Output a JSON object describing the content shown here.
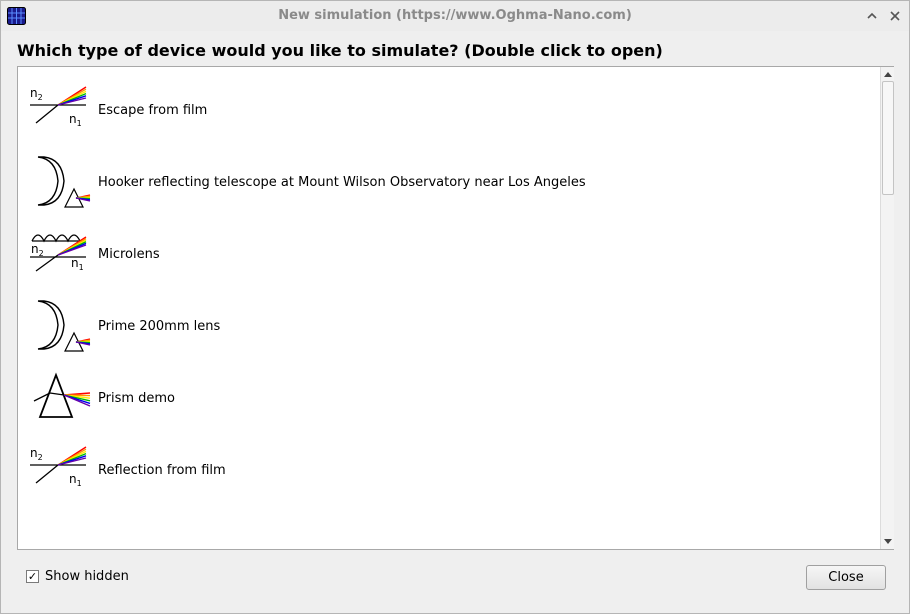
{
  "window": {
    "title": "New simulation (https://www.Oghma-Nano.com)",
    "app_icon": "grid-app-icon"
  },
  "heading": "Which type of device would you like to simulate? (Double click to open)",
  "list": {
    "items": [
      {
        "label": "Escape from film",
        "icon": "refraction-icon"
      },
      {
        "label": "Hooker reflecting telescope at Mount Wilson Observatory near Los Angeles",
        "icon": "mirror-prism-icon"
      },
      {
        "label": "Microlens",
        "icon": "microlens-icon"
      },
      {
        "label": "Prime 200mm lens",
        "icon": "mirror-prism-icon"
      },
      {
        "label": "Prism demo",
        "icon": "prism-icon"
      },
      {
        "label": "Reflection from film",
        "icon": "refraction-icon"
      }
    ],
    "n_labels": {
      "top": "n",
      "top_sub": "2",
      "bottom": "n",
      "bottom_sub": "1"
    }
  },
  "footer": {
    "show_hidden_label": "Show hidden",
    "show_hidden_checked": true,
    "check_glyph": "✓",
    "close_label": "Close"
  },
  "colors": {
    "rainbow": [
      "#ff0000",
      "#ff9900",
      "#ffee00",
      "#00bb00",
      "#0000ee",
      "#6600aa"
    ]
  }
}
